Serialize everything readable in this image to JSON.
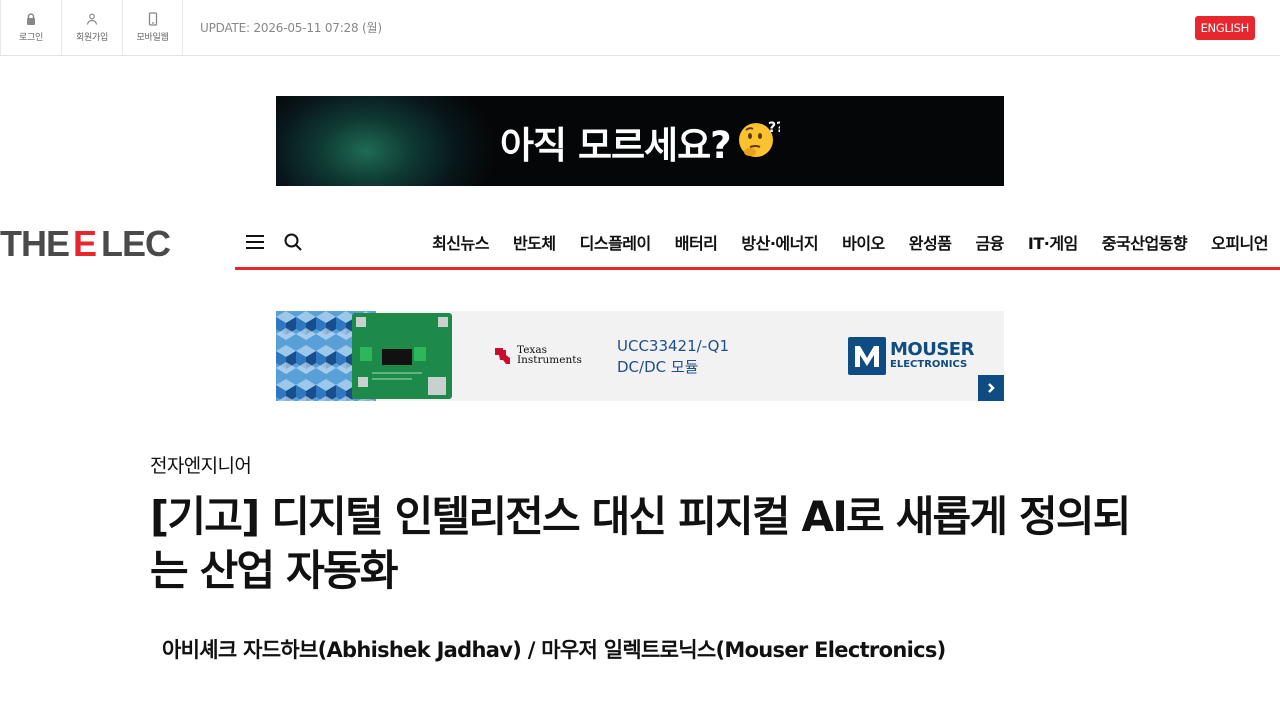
{
  "topbar": {
    "login": "로그인",
    "signup": "회원가입",
    "mobile": "모바일웹",
    "update": "UPDATE: 2026-05-11 07:28 (월)",
    "english": "ENGLISH"
  },
  "banner_top": {
    "text": "아직 모르세요?"
  },
  "header": {
    "logo": "THEELEC",
    "nav": [
      "최신뉴스",
      "반도체",
      "디스플레이",
      "배터리",
      "방산·에너지",
      "바이오",
      "완성품",
      "금융",
      "IT·게임",
      "중국산업동향",
      "오피니언"
    ]
  },
  "banner_ad": {
    "ti_line1": "Texas",
    "ti_line2": "Instruments",
    "product_line1": "UCC33421/-Q1",
    "product_line2": "DC/DC 모듈",
    "mouser_line1": "MOUSER",
    "mouser_line2": "ELECTRONICS"
  },
  "article": {
    "section": "전자엔지니어",
    "title": "[기고] 디지털 인텔리전스 대신 피지컬 AI로 새롭게 정의되는 산업 자동화",
    "subtitle": "아비셰크 자드하브(Abhishek Jadhav) / 마우저 일렉트로닉스(Mouser Electronics)"
  },
  "colors": {
    "accent": "#e8262d",
    "mouser_blue": "#0f4c81",
    "logo_gray": "#4a4a4a"
  }
}
